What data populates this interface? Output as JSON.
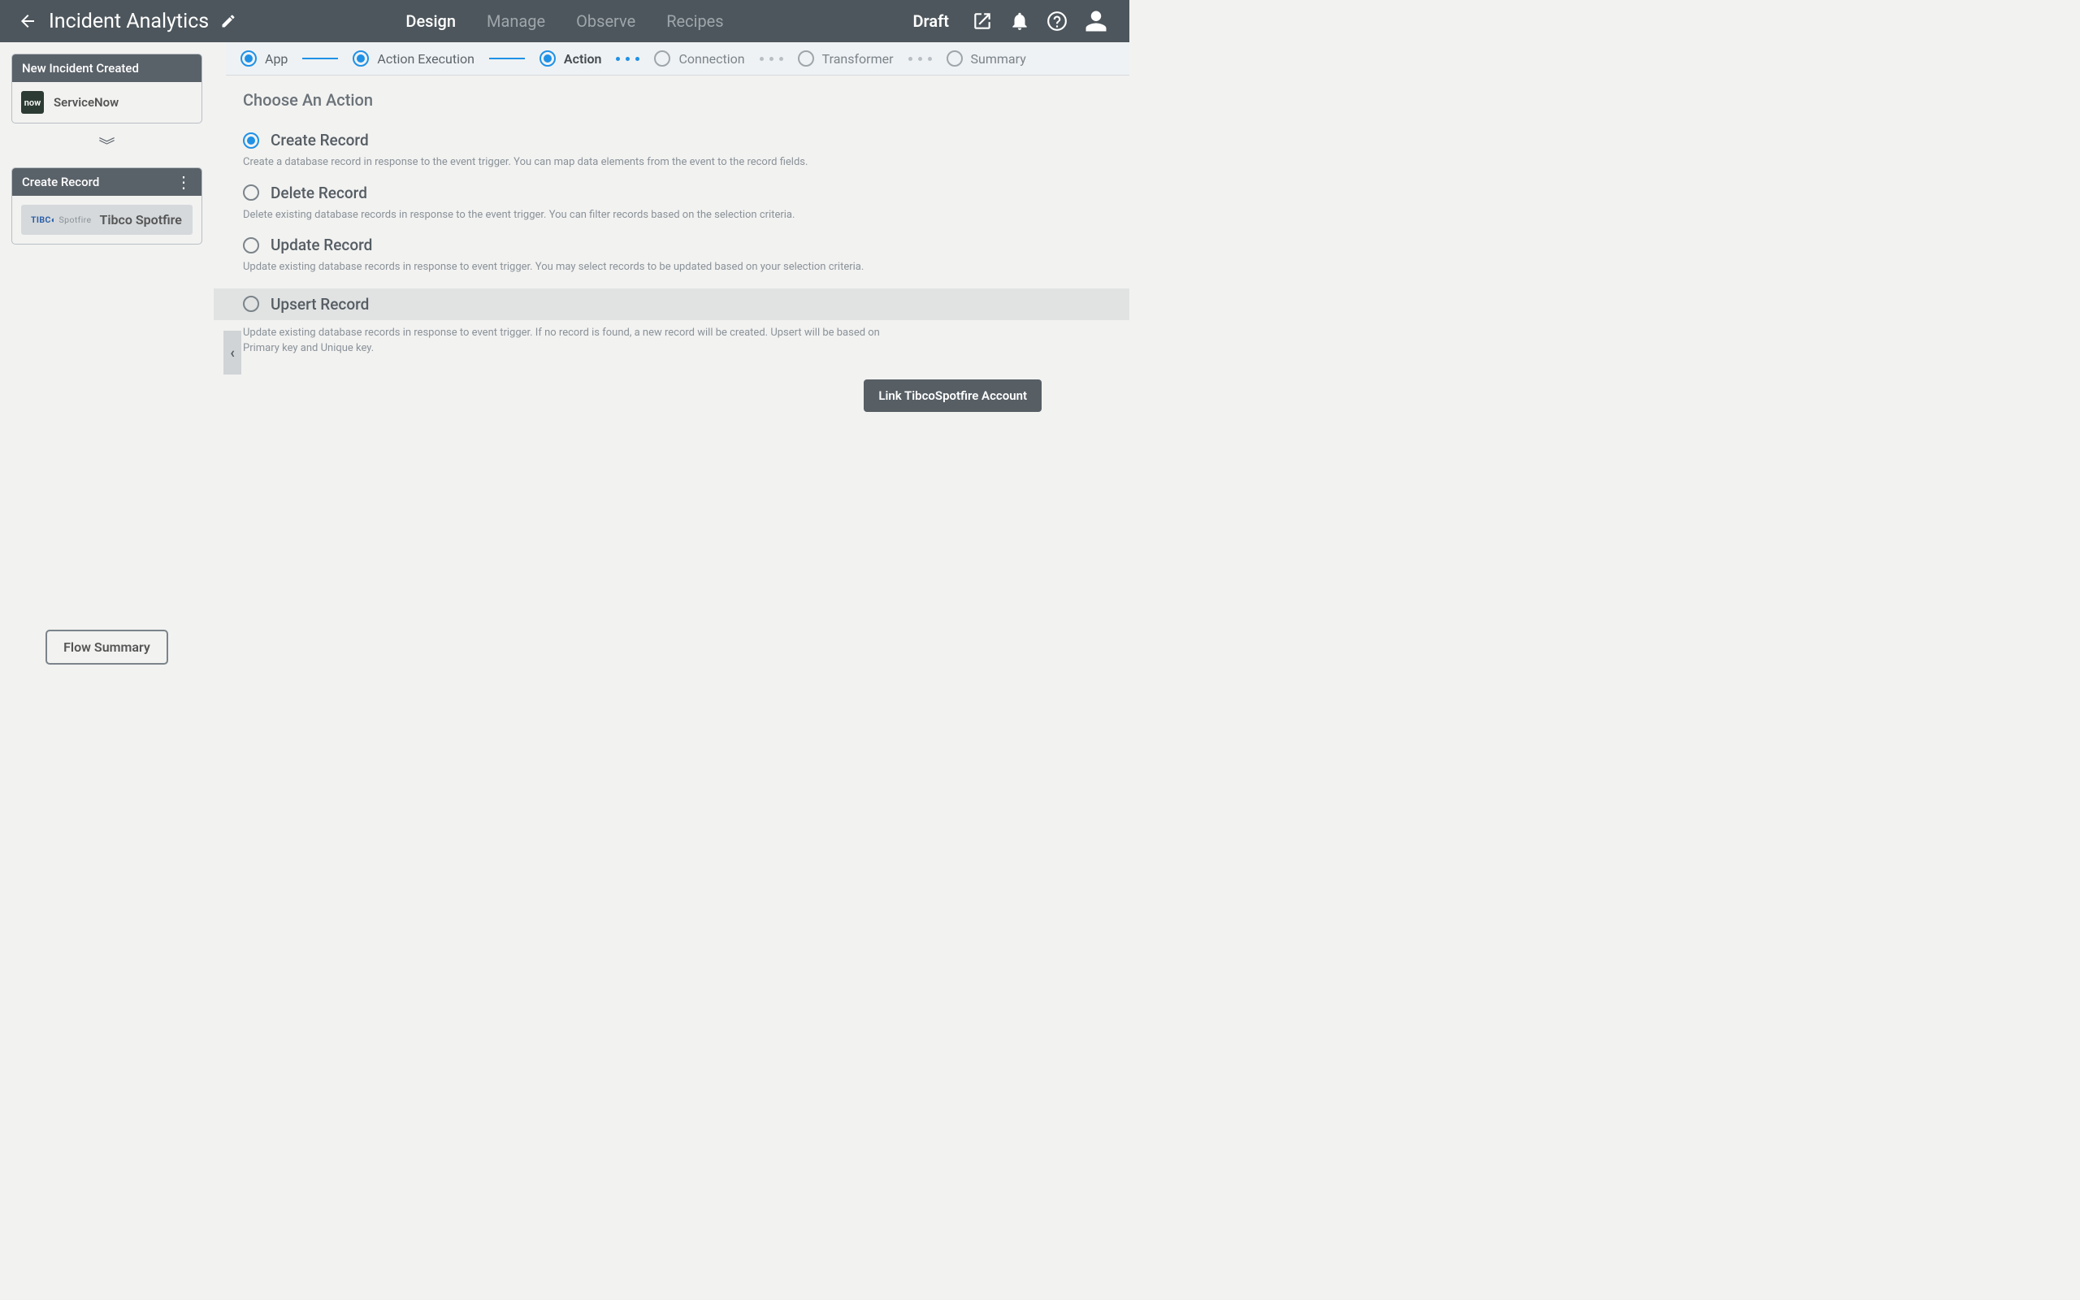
{
  "header": {
    "title": "Incident Analytics",
    "tabs": [
      "Design",
      "Manage",
      "Observe",
      "Recipes"
    ],
    "active_tab": 0,
    "status": "Draft"
  },
  "sidebar": {
    "node1": {
      "header": "New Incident Created",
      "app_name": "ServiceNow",
      "app_icon_text": "now"
    },
    "node2": {
      "header": "Create Record",
      "chip_logo_a": "TIBC",
      "chip_logo_b": "Spotfire",
      "chip_label": "Tibco Spotfire"
    },
    "flow_summary_btn": "Flow Summary"
  },
  "breadcrumb": {
    "steps": [
      "App",
      "Action Execution",
      "Action",
      "Connection",
      "Transformer",
      "Summary"
    ],
    "completed": [
      0,
      1
    ],
    "current": 2
  },
  "content": {
    "section_title": "Choose An Action",
    "actions": [
      {
        "title": "Create Record",
        "desc": "Create a database record in response to the event trigger. You can map data elements from the event to the record fields.",
        "selected": true
      },
      {
        "title": "Delete Record",
        "desc": "Delete existing database records in response to the event trigger. You can filter records based on the selection criteria."
      },
      {
        "title": "Update Record",
        "desc": "Update existing database records in response to event trigger. You may select records to be updated based on your selection criteria."
      },
      {
        "title": "Upsert Record",
        "desc": "Update existing database records in response to event trigger. If no record is found, a new record will be created. Upsert will be based on Primary key and Unique key.",
        "highlight_row": true
      }
    ],
    "link_button": "Link TibcoSpotfire Account"
  }
}
